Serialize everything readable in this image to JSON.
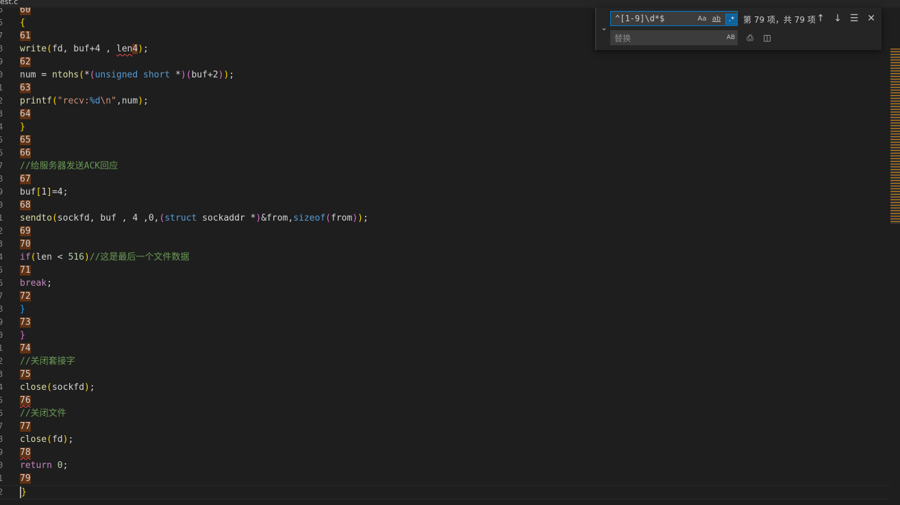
{
  "tab": {
    "label": "est.c"
  },
  "find": {
    "query": "^[1-9]\\d*$",
    "opt_case": "Aa",
    "opt_word": "ab",
    "opt_regex": ".*",
    "match_count": "第 79 项，共 79 项",
    "replace_placeholder": "替换",
    "opt_preserve_case": "AB"
  },
  "gutter_numbers": [
    "6",
    "5",
    "7",
    "8",
    "9",
    "0",
    "1",
    "2",
    "3",
    "4",
    "5",
    "6",
    "7",
    "8",
    "9",
    "0",
    "1",
    "2",
    "3",
    "4",
    "5",
    "6",
    "7",
    "8",
    "9",
    "0",
    "1",
    "2",
    "3",
    "4",
    "5",
    "6",
    "7",
    "8",
    "9",
    "0",
    "1",
    "2"
  ],
  "lines": [
    [
      {
        "t": "60",
        "cls": "m"
      }
    ],
    [
      {
        "t": "{",
        "cls": "p1"
      }
    ],
    [
      {
        "t": "61",
        "cls": "m"
      }
    ],
    [
      {
        "t": "write",
        "cls": "f"
      },
      {
        "t": "(",
        "cls": "p1"
      },
      {
        "t": "fd, buf+4 , "
      },
      {
        "t": "len",
        "cls": "squig"
      },
      {
        "t": "4",
        "cls": "m"
      },
      {
        "t": ")",
        "cls": "p1"
      },
      {
        "t": ";"
      }
    ],
    [
      {
        "t": "62",
        "cls": "m"
      }
    ],
    [
      {
        "t": "num = "
      },
      {
        "t": "ntohs",
        "cls": "f"
      },
      {
        "t": "(",
        "cls": "p1"
      },
      {
        "t": "*"
      },
      {
        "t": "(",
        "cls": "p2"
      },
      {
        "t": "unsigned short",
        "cls": "k"
      },
      {
        "t": " *"
      },
      {
        "t": ")",
        "cls": "p2"
      },
      {
        "t": "(",
        "cls": "p2"
      },
      {
        "t": "buf+2"
      },
      {
        "t": ")",
        "cls": "p2"
      },
      {
        "t": ")",
        "cls": "p1"
      },
      {
        "t": ";"
      }
    ],
    [
      {
        "t": "63",
        "cls": "m"
      }
    ],
    [
      {
        "t": "printf",
        "cls": "f"
      },
      {
        "t": "(",
        "cls": "p1"
      },
      {
        "t": "\"recv:",
        "cls": "s"
      },
      {
        "t": "%d",
        "cls": "k"
      },
      {
        "t": "\\n\"",
        "cls": "s"
      },
      {
        "t": ",num"
      },
      {
        "t": ")",
        "cls": "p1"
      },
      {
        "t": ";"
      }
    ],
    [
      {
        "t": "64",
        "cls": "m"
      }
    ],
    [
      {
        "t": "}",
        "cls": "p1"
      }
    ],
    [
      {
        "t": "65",
        "cls": "m"
      }
    ],
    [
      {
        "t": "66",
        "cls": "m"
      }
    ],
    [
      {
        "t": "//给服务器发送ACK回应",
        "cls": "c"
      }
    ],
    [
      {
        "t": "67",
        "cls": "m"
      }
    ],
    [
      {
        "t": "buf"
      },
      {
        "t": "[",
        "cls": "p1"
      },
      {
        "t": "1"
      },
      {
        "t": "]",
        "cls": "p1"
      },
      {
        "t": "=4;"
      }
    ],
    [
      {
        "t": "68",
        "cls": "m"
      }
    ],
    [
      {
        "t": "sendto",
        "cls": "f"
      },
      {
        "t": "(",
        "cls": "p1"
      },
      {
        "t": "sockfd, buf , 4 ,0,"
      },
      {
        "t": "(",
        "cls": "p2"
      },
      {
        "t": "struct",
        "cls": "k"
      },
      {
        "t": " sockaddr *"
      },
      {
        "t": ")",
        "cls": "p2"
      },
      {
        "t": "&from,"
      },
      {
        "t": "sizeof",
        "cls": "k"
      },
      {
        "t": "(",
        "cls": "p2"
      },
      {
        "t": "from"
      },
      {
        "t": ")",
        "cls": "p2"
      },
      {
        "t": ")",
        "cls": "p1"
      },
      {
        "t": ";"
      }
    ],
    [
      {
        "t": "69",
        "cls": "m"
      }
    ],
    [
      {
        "t": "70",
        "cls": "m"
      }
    ],
    [
      {
        "t": "if",
        "cls": "kw2"
      },
      {
        "t": "(",
        "cls": "p1"
      },
      {
        "t": "len < "
      },
      {
        "t": "516",
        "cls": "n"
      },
      {
        "t": ")",
        "cls": "p1"
      },
      {
        "t": "//这是最后一个文件数据",
        "cls": "c"
      }
    ],
    [
      {
        "t": "71",
        "cls": "m"
      }
    ],
    [
      {
        "t": "break",
        "cls": "kw2"
      },
      {
        "t": ";"
      }
    ],
    [
      {
        "t": "72",
        "cls": "m"
      }
    ],
    [
      {
        "t": "}",
        "cls": "p3"
      }
    ],
    [
      {
        "t": "73",
        "cls": "m"
      }
    ],
    [
      {
        "t": "}",
        "cls": "p2"
      }
    ],
    [
      {
        "t": "74",
        "cls": "m"
      }
    ],
    [
      {
        "t": "//关闭套接字",
        "cls": "c"
      }
    ],
    [
      {
        "t": "75",
        "cls": "m"
      }
    ],
    [
      {
        "t": "close",
        "cls": "f"
      },
      {
        "t": "(",
        "cls": "p1"
      },
      {
        "t": "sockfd"
      },
      {
        "t": ")",
        "cls": "p1"
      },
      {
        "t": ";"
      }
    ],
    [
      {
        "t": "76",
        "cls": "m squig"
      }
    ],
    [
      {
        "t": "//关闭文件",
        "cls": "c"
      }
    ],
    [
      {
        "t": "77",
        "cls": "m"
      }
    ],
    [
      {
        "t": "close",
        "cls": "f"
      },
      {
        "t": "(",
        "cls": "p1"
      },
      {
        "t": "fd"
      },
      {
        "t": ")",
        "cls": "p1"
      },
      {
        "t": ";"
      }
    ],
    [
      {
        "t": "78",
        "cls": "m squig"
      }
    ],
    [
      {
        "t": "return",
        "cls": "kw2"
      },
      {
        "t": " "
      },
      {
        "t": "0",
        "cls": "n"
      },
      {
        "t": ";"
      }
    ],
    [
      {
        "t": "79",
        "cls": "m"
      }
    ],
    [
      {
        "t": "}",
        "cls": "p1"
      }
    ]
  ]
}
